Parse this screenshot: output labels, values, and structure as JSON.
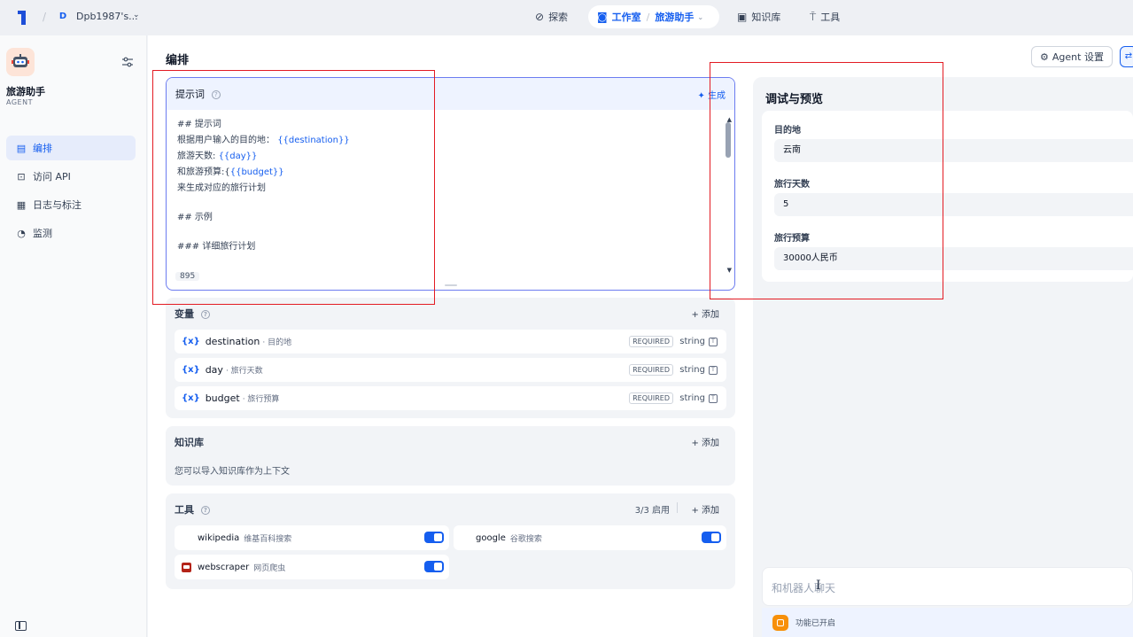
{
  "topbar": {
    "workspace_initial": "D",
    "workspace_name": "Dpb1987's...",
    "nav_explore": "探索",
    "nav_studio": "工作室",
    "nav_app": "旅游助手",
    "nav_knowledge": "知识库",
    "nav_tools": "工具"
  },
  "sidebar": {
    "app_name": "旅游助手",
    "app_mode": "AGENT",
    "items": [
      {
        "label": "编排",
        "icon": "layout-icon",
        "active": true
      },
      {
        "label": "访问 API",
        "icon": "terminal-icon",
        "active": false
      },
      {
        "label": "日志与标注",
        "icon": "file-list-icon",
        "active": false
      },
      {
        "label": "监测",
        "icon": "dashboard-icon",
        "active": false
      }
    ]
  },
  "main": {
    "title": "编排",
    "agent_settings_label": "Agent 设置"
  },
  "prompt": {
    "title": "提示词",
    "generate_label": "生成",
    "lines": {
      "l1": "## 提示词",
      "l2_pre": "根据用户输入的目的地：",
      "l2_var": "{{destination}}",
      "l3_pre": "旅游天数:",
      "l3_var": "{{day}}",
      "l4_pre": "和旅游预算:{",
      "l4_var": "{{budget}}",
      "l5": "来生成对应的旅行计划",
      "l6": "## 示例",
      "l7": "### 详细旅行计划"
    },
    "char_count": "895"
  },
  "variables": {
    "title": "变量",
    "add_label": "添加",
    "rows": [
      {
        "key": "destination",
        "label": "· 目的地",
        "required": "REQUIRED",
        "type": "string"
      },
      {
        "key": "day",
        "label": "· 旅行天数",
        "required": "REQUIRED",
        "type": "string"
      },
      {
        "key": "budget",
        "label": "· 旅行预算",
        "required": "REQUIRED",
        "type": "string"
      }
    ]
  },
  "knowledge": {
    "title": "知识库",
    "add_label": "添加",
    "description": "您可以导入知识库作为上下文"
  },
  "tools": {
    "title": "工具",
    "count": "3/3 启用",
    "add_label": "添加",
    "items": [
      {
        "name": "wikipedia",
        "label": "维基百科搜索",
        "enabled": true
      },
      {
        "name": "google",
        "label": "谷歌搜索",
        "enabled": true
      },
      {
        "name": "webscraper",
        "label": "网页爬虫",
        "enabled": true
      }
    ]
  },
  "debug": {
    "title": "调试与预览",
    "fields": [
      {
        "label": "目的地",
        "value": "云南"
      },
      {
        "label": "旅行天数",
        "value": "5"
      },
      {
        "label": "旅行预算",
        "value": "30000人民币"
      }
    ],
    "chat_placeholder": "和机器人聊天",
    "feature_status": "功能已开启"
  },
  "colors": {
    "accent": "#155eef",
    "annotation_red": "#e31b23",
    "prompt_border": "#6c7cf0"
  }
}
